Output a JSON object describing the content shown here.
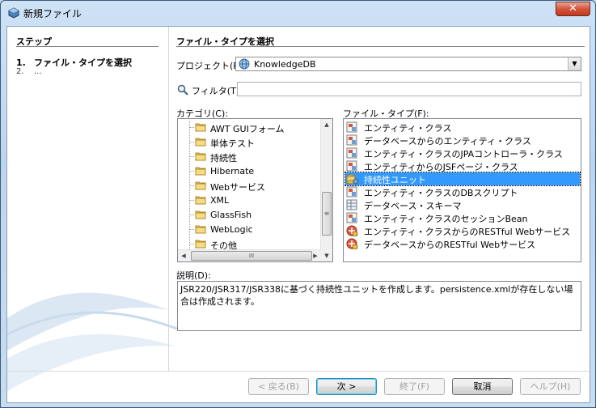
{
  "window": {
    "title": "新規ファイル",
    "close_glyph": "✕"
  },
  "steps": {
    "title": "ステップ",
    "items": [
      {
        "num": "1.",
        "label": "ファイル・タイプを選択"
      },
      {
        "num": "2.",
        "label": "..."
      }
    ]
  },
  "panel": {
    "title": "ファイル・タイプを選択",
    "project_label": "プロジェクト(P):",
    "project_value": "KnowledgeDB",
    "filter_label": "フィルタ(T):",
    "filter_value": "",
    "categories_label": "カテゴリ(C):",
    "filetypes_label": "ファイル・タイプ(F):",
    "description_label": "説明(D):"
  },
  "categories": [
    "AWT GUIフォーム",
    "単体テスト",
    "持続性",
    "Hibernate",
    "Webサービス",
    "XML",
    "GlassFish",
    "WebLogic",
    "その他"
  ],
  "file_types": [
    {
      "label": "エンティティ・クラス",
      "icon": "entity-icon"
    },
    {
      "label": "データベースからのエンティティ・クラス",
      "icon": "entity-icon"
    },
    {
      "label": "エンティティ・クラスのJPAコントローラ・クラス",
      "icon": "entity-icon"
    },
    {
      "label": "エンティティからのJSFページ・クラス",
      "icon": "entity-icon"
    },
    {
      "label": "持続性ユニット",
      "icon": "persistence-unit-icon",
      "selected": true
    },
    {
      "label": "エンティティ・クラスのDBスクリプト",
      "icon": "entity-icon"
    },
    {
      "label": "データベース・スキーマ",
      "icon": "database-schema-icon"
    },
    {
      "label": "エンティティ・クラスのセッションBean",
      "icon": "entity-icon"
    },
    {
      "label": "エンティティ・クラスからのRESTful Webサービス",
      "icon": "rest-icon"
    },
    {
      "label": "データベースからのRESTful Webサービス",
      "icon": "rest-icon"
    }
  ],
  "description": "JSR220/JSR317/JSR338に基づく持続性ユニットを作成します。persistence.xmlが存在しない場合は作成されます。",
  "scroll_glyphs": {
    "up": "▲",
    "down": "▼",
    "left": "◀",
    "right": "▶",
    "grip_h": "III",
    "grip_v": "≡"
  },
  "buttons": {
    "back": "< 戻る(B)",
    "next": "次 >",
    "finish": "終了(F)",
    "cancel": "取消",
    "help": "ヘルプ(H)"
  },
  "colors": {
    "selection": "#3399ff",
    "folder": "#f0c75a"
  }
}
